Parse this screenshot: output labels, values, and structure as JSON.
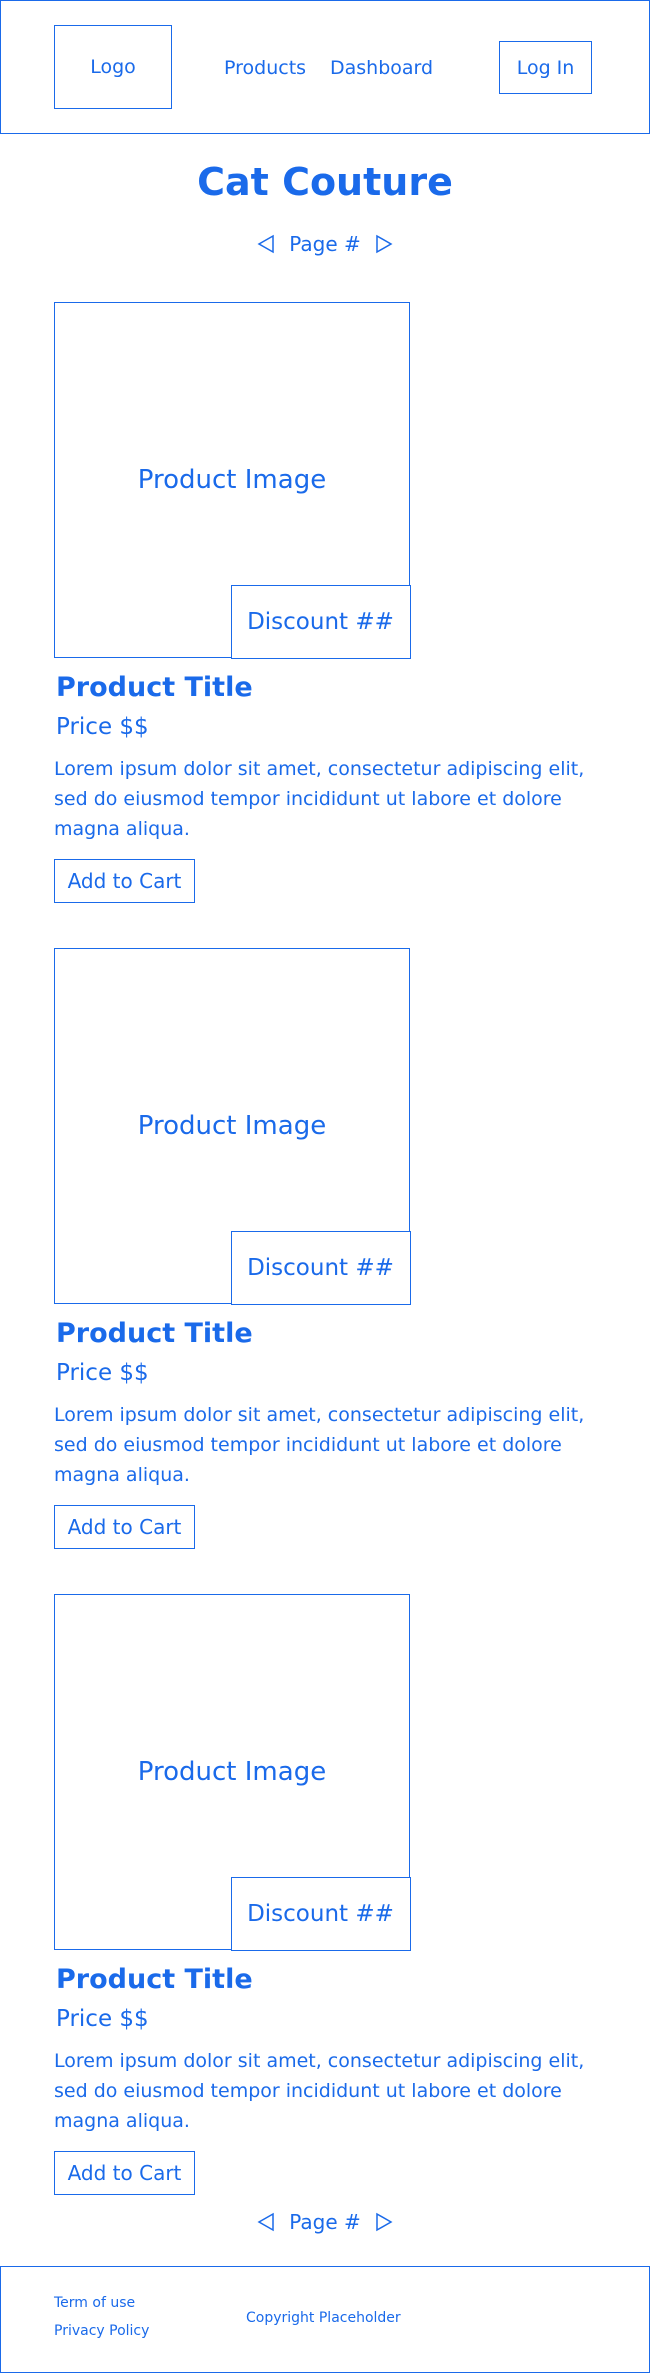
{
  "header": {
    "logo": "Logo",
    "nav": [
      "Products",
      "Dashboard"
    ],
    "login": "Log In"
  },
  "title": "Cat Couture",
  "pager": {
    "label": "Page #"
  },
  "products": [
    {
      "image": "Product Image",
      "discount": "Discount ##",
      "title": "Product Title",
      "price": "Price $$",
      "description": "Lorem ipsum dolor sit amet, consectetur adipiscing elit, sed do eiusmod tempor incididunt ut labore et dolore magna aliqua.",
      "cart": "Add to Cart"
    },
    {
      "image": "Product Image",
      "discount": "Discount ##",
      "title": "Product Title",
      "price": "Price $$",
      "description": "Lorem ipsum dolor sit amet, consectetur adipiscing elit, sed do eiusmod tempor incididunt ut labore et dolore magna aliqua.",
      "cart": "Add to Cart"
    },
    {
      "image": "Product Image",
      "discount": "Discount ##",
      "title": "Product Title",
      "price": "Price $$",
      "description": "Lorem ipsum dolor sit amet, consectetur adipiscing elit, sed do eiusmod tempor incididunt ut labore et dolore magna aliqua.",
      "cart": "Add to Cart"
    }
  ],
  "footer": {
    "links": [
      "Term of use",
      "Privacy Policy"
    ],
    "copyright": "Copyright Placeholder"
  },
  "colors": {
    "accent": "#1a6aea",
    "background": "#ffffff"
  },
  "icons": {
    "prev": "triangle-left-icon",
    "next": "triangle-right-icon"
  }
}
